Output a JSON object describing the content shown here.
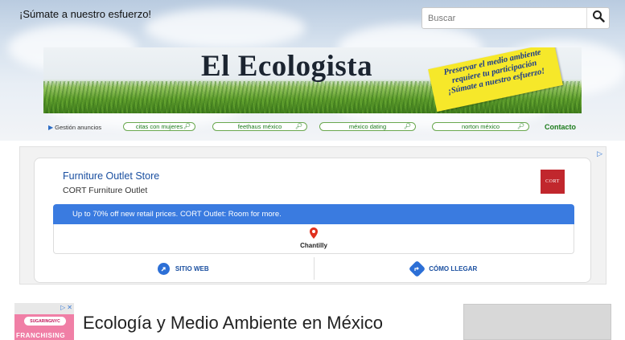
{
  "header": {
    "tagline": "¡Súmate a nuestro esfuerzo!",
    "search_placeholder": "Buscar",
    "search_icon": "search-icon"
  },
  "banner": {
    "site_title": "El Ecologista",
    "sticker_lines": [
      "Preservar el medio ambiente",
      "requiere tu participación",
      "¡Súmate a nuestro esfuerzo!"
    ]
  },
  "nav": {
    "label": "Gestión anuncios",
    "pills": [
      "citas con mujeres",
      "feethaus méxico",
      "méxico dating",
      "norton méxico"
    ],
    "contact": "Contacto"
  },
  "ad": {
    "title": "Furniture Outlet Store",
    "subtitle": "CORT Furniture Outlet",
    "logo_text": "CORT",
    "banner_text": "Up to 70% off new retail prices. CORT Outlet: Room for more.",
    "location": "Chantilly",
    "actions": [
      "SITIO WEB",
      "CÓMO LLEGAR"
    ],
    "accent": "#3a7be0"
  },
  "bottom": {
    "page_title": "Ecología y Medio Ambiente en México",
    "small_ad_brand": "SUGARINGNYC",
    "small_ad_text": "FRANCHISING"
  }
}
